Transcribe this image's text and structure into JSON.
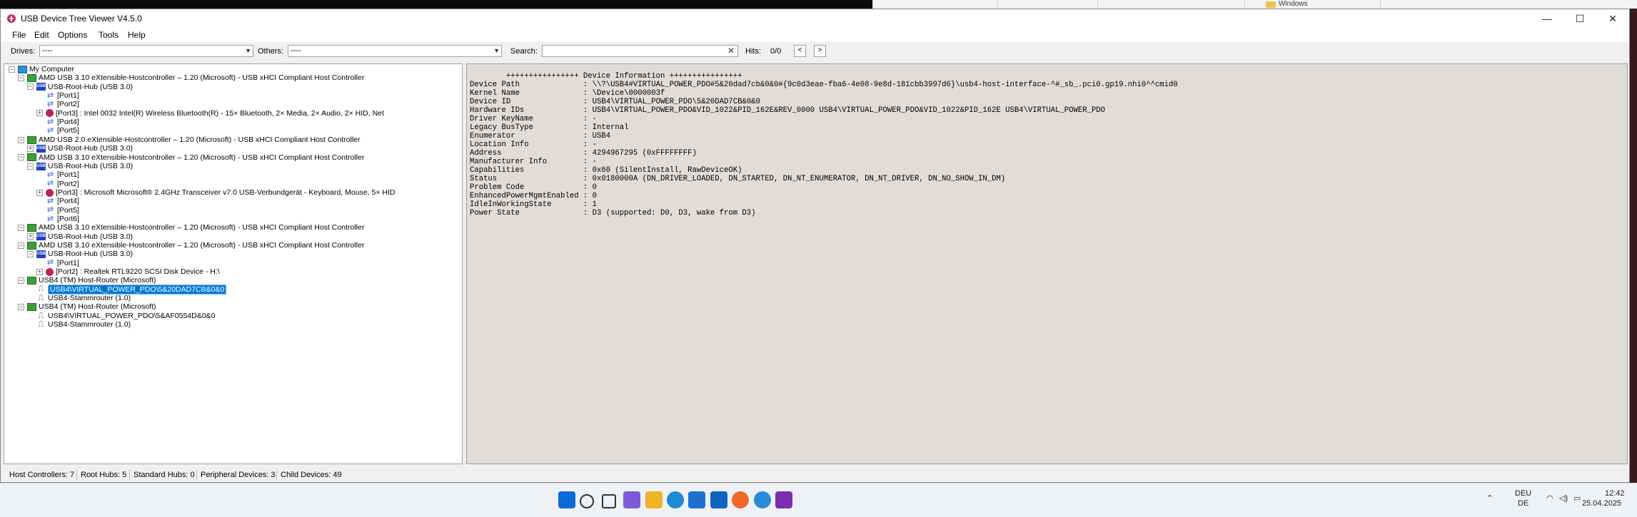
{
  "window": {
    "title": "USB Device Tree Viewer V4.5.0"
  },
  "background_window": {
    "label": "Windows"
  },
  "menu": [
    "File",
    "Edit",
    "Options",
    "Tools",
    "Help"
  ],
  "toolbar": {
    "drives_label": "Drives:",
    "drives_value": "----",
    "others_label": "Others:",
    "others_value": "----",
    "search_label": "Search:",
    "search_value": "",
    "hits_label": "Hits:",
    "hits_value": "0/0",
    "prev": "<",
    "next": ">"
  },
  "tree": [
    {
      "depth": 0,
      "exp": "-",
      "icon": "pc",
      "label": "My Computer"
    },
    {
      "depth": 1,
      "exp": "-",
      "icon": "hc",
      "label": "AMD USB 3.10 eXtensible-Hostcontroller – 1.20 (Microsoft) - USB xHCI Compliant Host Controller"
    },
    {
      "depth": 2,
      "exp": "-",
      "icon": "hub",
      "label": "USB-Root-Hub (USB 3.0)"
    },
    {
      "depth": 3,
      "exp": "",
      "icon": "port",
      "label": "[Port1]"
    },
    {
      "depth": 3,
      "exp": "",
      "icon": "port",
      "label": "[Port2]"
    },
    {
      "depth": 3,
      "exp": "+",
      "icon": "dev",
      "label": "[Port3] : Intel 0032 Intel(R) Wireless Bluetooth(R) - 15× Bluetooth, 2× Media, 2× Audio, 2× HID, Net"
    },
    {
      "depth": 3,
      "exp": "",
      "icon": "port",
      "label": "[Port4]"
    },
    {
      "depth": 3,
      "exp": "",
      "icon": "port",
      "label": "[Port5]"
    },
    {
      "depth": 1,
      "exp": "-",
      "icon": "hc",
      "label": "AMD USB 2.0 eXtensible-Hostcontroller – 1.20 (Microsoft) - USB xHCI Compliant Host Controller"
    },
    {
      "depth": 2,
      "exp": "+",
      "icon": "hub",
      "label": "USB-Root-Hub (USB 3.0)"
    },
    {
      "depth": 1,
      "exp": "-",
      "icon": "hc",
      "label": "AMD USB 3.10 eXtensible-Hostcontroller – 1.20 (Microsoft) - USB xHCI Compliant Host Controller"
    },
    {
      "depth": 2,
      "exp": "-",
      "icon": "hub",
      "label": "USB-Root-Hub (USB 3.0)"
    },
    {
      "depth": 3,
      "exp": "",
      "icon": "port",
      "label": "[Port1]"
    },
    {
      "depth": 3,
      "exp": "",
      "icon": "port",
      "label": "[Port2]"
    },
    {
      "depth": 3,
      "exp": "+",
      "icon": "dev",
      "label": "[Port3] : Microsoft Microsoft® 2.4GHz Transceiver v7.0 USB-Verbundgerät - Keyboard, Mouse, 5× HID"
    },
    {
      "depth": 3,
      "exp": "",
      "icon": "port",
      "label": "[Port4]"
    },
    {
      "depth": 3,
      "exp": "",
      "icon": "port",
      "label": "[Port5]"
    },
    {
      "depth": 3,
      "exp": "",
      "icon": "port",
      "label": "[Port6]"
    },
    {
      "depth": 1,
      "exp": "-",
      "icon": "hc",
      "label": "AMD USB 3.10 eXtensible-Hostcontroller – 1.20 (Microsoft) - USB xHCI Compliant Host Controller"
    },
    {
      "depth": 2,
      "exp": "+",
      "icon": "hub",
      "label": "USB-Root-Hub (USB 3.0)"
    },
    {
      "depth": 1,
      "exp": "-",
      "icon": "hc",
      "label": "AMD USB 3.10 eXtensible-Hostcontroller – 1.20 (Microsoft) - USB xHCI Compliant Host Controller"
    },
    {
      "depth": 2,
      "exp": "-",
      "icon": "hub",
      "label": "USB-Root-Hub (USB 3.0)"
    },
    {
      "depth": 3,
      "exp": "",
      "icon": "port",
      "label": "[Port1]"
    },
    {
      "depth": 3,
      "exp": "+",
      "icon": "dev",
      "label": "[Port2] : Realtek RTL9220 SCSI Disk Device - H:\\"
    },
    {
      "depth": 1,
      "exp": "-",
      "icon": "hc",
      "label": "USB4 (TM) Host-Router (Microsoft)"
    },
    {
      "depth": 2,
      "exp": "",
      "icon": "usb4",
      "label": "USB4\\VIRTUAL_POWER_PDO\\5&20DAD7CB&0&0",
      "selected": true
    },
    {
      "depth": 2,
      "exp": "",
      "icon": "usb4",
      "label": "USB4-Stammrouter (1.0)"
    },
    {
      "depth": 1,
      "exp": "-",
      "icon": "hc",
      "label": "USB4 (TM) Host-Router (Microsoft)"
    },
    {
      "depth": 2,
      "exp": "",
      "icon": "usb4",
      "label": "USB4\\VIRTUAL_POWER_PDO\\5&AF0554D&0&0"
    },
    {
      "depth": 2,
      "exp": "",
      "icon": "usb4",
      "label": "USB4-Stammrouter (1.0)"
    }
  ],
  "info_header": "        ++++++++++++++++ Device Information ++++++++++++++++",
  "info": [
    {
      "key": "Device Path",
      "value": "\\\\?\\USB4#VIRTUAL_POWER_PDO#5&20dad7cb&0&0#{9c0d3eae-fba6-4e08-9e8d-181cbb3997d6}\\usb4-host-interface-^#_sb_.pci0.gp19.nhi0^^cmid0"
    },
    {
      "key": "Kernel Name",
      "value": "\\Device\\0000003f"
    },
    {
      "key": "Device ID",
      "value": "USB4\\VIRTUAL_POWER_PDO\\5&20DAD7CB&0&0"
    },
    {
      "key": "Hardware IDs",
      "value": "USB4\\VIRTUAL_POWER_PDO&VID_1022&PID_162E&REV_0000 USB4\\VIRTUAL_POWER_PDO&VID_1022&PID_162E USB4\\VIRTUAL_POWER_PDO"
    },
    {
      "key": "Driver KeyName",
      "value": "-"
    },
    {
      "key": "Legacy BusType",
      "value": "Internal"
    },
    {
      "key": "Enumerator",
      "value": "USB4"
    },
    {
      "key": "Location Info",
      "value": "-"
    },
    {
      "key": "Address",
      "value": "4294967295 (0xFFFFFFFF)"
    },
    {
      "key": "Manufacturer Info",
      "value": "-"
    },
    {
      "key": "Capabilities",
      "value": "0x60 (SilentInstall, RawDeviceOK)"
    },
    {
      "key": "Status",
      "value": "0x0180000A (DN_DRIVER_LOADED, DN_STARTED, DN_NT_ENUMERATOR, DN_NT_DRIVER, DN_NO_SHOW_IN_DM)"
    },
    {
      "key": "Problem Code",
      "value": "0"
    },
    {
      "key": "EnhancedPowerMgmtEnabled",
      "value": "0"
    },
    {
      "key": "IdleInWorkingState",
      "value": "1"
    },
    {
      "key": "Power State",
      "value": "D3 (supported: D0, D3, wake from D3)"
    }
  ],
  "status": {
    "host_controllers": "Host Controllers: 7",
    "root_hubs": "Root Hubs: 5",
    "standard_hubs": "Standard Hubs: 0",
    "peripheral_devices": "Peripheral Devices: 3",
    "child_devices": "Child Devices: 49"
  },
  "taskbar": {
    "lang_top": "DEU",
    "lang_bottom": "DE",
    "time": "12:42",
    "date": "25.04.2025",
    "apps": [
      {
        "name": "start-icon",
        "color": "#0a6ad6"
      },
      {
        "name": "search-icon",
        "color": "#333333"
      },
      {
        "name": "task-view-icon",
        "color": "#333333"
      },
      {
        "name": "copilot-icon",
        "color": "#7b5cd6"
      },
      {
        "name": "file-explorer-icon",
        "color": "#f0b429"
      },
      {
        "name": "edge-icon",
        "color": "#1d8ad6"
      },
      {
        "name": "store-icon",
        "color": "#1f6fd1"
      },
      {
        "name": "outlook-icon",
        "color": "#0f64c1"
      },
      {
        "name": "firefox-icon",
        "color": "#f06a25"
      },
      {
        "name": "chrome-like-icon",
        "color": "#2b8ad8"
      },
      {
        "name": "usb-tree-viewer-icon",
        "color": "#7a2fb0"
      }
    ]
  }
}
